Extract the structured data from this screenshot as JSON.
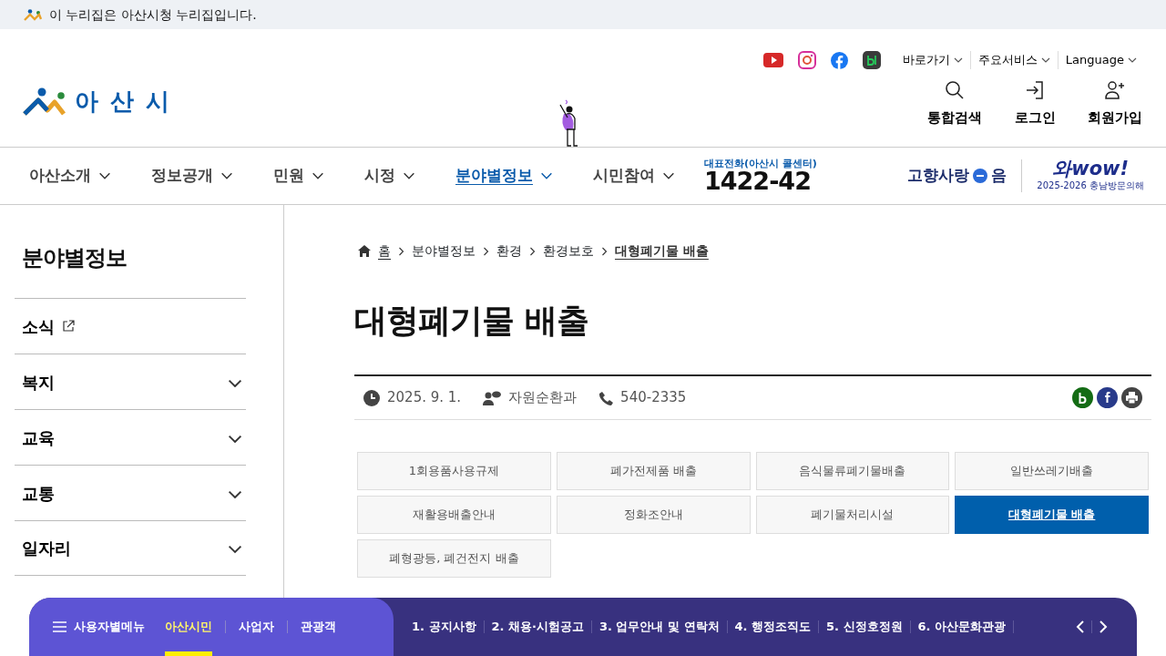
{
  "notice_bar": {
    "text": "이 누리집은 아산시청 누리집입니다."
  },
  "header": {
    "logo_text": "아 산 시",
    "util_menus": [
      {
        "label": "바로가기"
      },
      {
        "label": "주요서비스"
      },
      {
        "label": "Language"
      }
    ],
    "actions": [
      {
        "kind": "search",
        "label": "통합검색"
      },
      {
        "kind": "login",
        "label": "로그인"
      },
      {
        "kind": "signup",
        "label": "회원가입"
      }
    ]
  },
  "nav": {
    "items": [
      {
        "label": "아산소개",
        "selected": false
      },
      {
        "label": "정보공개",
        "selected": false
      },
      {
        "label": "민원",
        "selected": false
      },
      {
        "label": "시정",
        "selected": false
      },
      {
        "label": "분야별정보",
        "selected": true
      },
      {
        "label": "시민참여",
        "selected": false
      }
    ],
    "call_center": {
      "caption": "대표전화(아산시 콜센터)",
      "number": "1422-42"
    },
    "hometown_banner": {
      "before": "고향사랑",
      "after": "음"
    },
    "visit_banner": {
      "title": "와wow!",
      "subtitle": "2025-2026 충남방문의해"
    }
  },
  "sidebar": {
    "title": "분야별정보",
    "items": [
      {
        "label": "소식",
        "kind": "external"
      },
      {
        "label": "복지",
        "kind": "expand"
      },
      {
        "label": "교육",
        "kind": "expand"
      },
      {
        "label": "교통",
        "kind": "expand"
      },
      {
        "label": "일자리",
        "kind": "expand"
      }
    ]
  },
  "breadcrumb": {
    "home": "홈",
    "items": [
      "분야별정보",
      "환경",
      "환경보호"
    ],
    "current": "대형폐기물 배출"
  },
  "page_title": "대형폐기물 배출",
  "meta": {
    "date": "2025. 9. 1.",
    "department": "자원순환과",
    "phone": "540-2335"
  },
  "sub_tabs": [
    {
      "label": "1회용품사용규제",
      "selected": false
    },
    {
      "label": "폐가전제품 배출",
      "selected": false
    },
    {
      "label": "음식물류폐기물배출",
      "selected": false
    },
    {
      "label": "일반쓰레기배출",
      "selected": false
    },
    {
      "label": "재활용배출안내",
      "selected": false
    },
    {
      "label": "정화조안내",
      "selected": false
    },
    {
      "label": "폐기물처리시설",
      "selected": false
    },
    {
      "label": "대형폐기물 배출",
      "selected": true
    },
    {
      "label": "폐형광등, 폐건전지 배출",
      "selected": false
    }
  ],
  "bottom_bar": {
    "menu_label": "사용자별메뉴",
    "user_tabs": [
      {
        "label": "아산시민",
        "selected": true
      },
      {
        "label": "사업자",
        "selected": false
      },
      {
        "label": "관광객",
        "selected": false
      }
    ],
    "links": [
      "1. 공지사항",
      "2. 채용·시험공고",
      "3. 업무안내 및 연락처",
      "4. 행정조직도",
      "5. 신정호정원",
      "6. 아산문화관광"
    ]
  }
}
